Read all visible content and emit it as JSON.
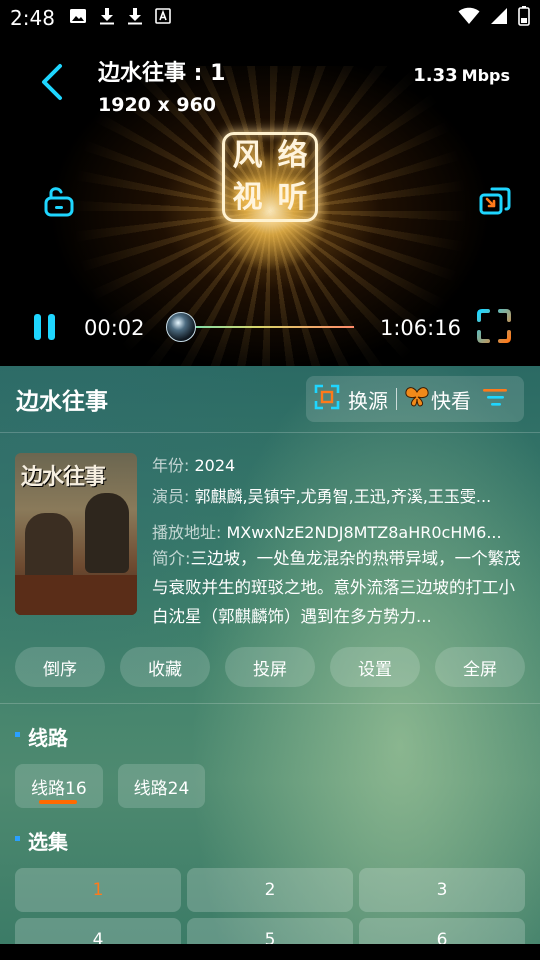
{
  "status_bar": {
    "time": "2:48",
    "left_icons": [
      "image-icon",
      "download-icon",
      "download-icon",
      "a-badge-icon"
    ],
    "right_icons": [
      "wifi-icon",
      "signal-icon",
      "battery-icon"
    ]
  },
  "player": {
    "title": "边水往事 : 1",
    "resolution": "1920 x 960",
    "bitrate_value": "1.33",
    "bitrate_unit": "Mbps",
    "logo_chars": [
      "风",
      "络",
      "视",
      "听"
    ],
    "current_time": "00:02",
    "total_time": "1:06:16",
    "accent_color": "#1fd6ff",
    "fullscreen_color": "#ff7a1a"
  },
  "details": {
    "title": "边水往事",
    "source_label": "换源",
    "quick_label": "快看",
    "poster_text": "边水往事",
    "year_label": "年份:",
    "year": "2024",
    "cast_label": "演员:",
    "cast": "郭麒麟,吴镇宇,尤勇智,王迅,齐溪,王玉雯...",
    "url_label": "播放地址:",
    "url": "MXwxNzE2NDJ8MTZ8aHR0cHM6...",
    "intro_label": "简介:",
    "intro": "三边坡，一处鱼龙混杂的热带异域，一个繁茂与衰败并生的斑驳之地。意外流落三边坡的打工小白沈星（郭麒麟饰）遇到在多方势力...",
    "actions": [
      "倒序",
      "收藏",
      "投屏",
      "设置",
      "全屏"
    ]
  },
  "lines": {
    "heading": "线路",
    "items": [
      "线路16",
      "线路24"
    ],
    "active_index": 0
  },
  "episodes": {
    "heading": "选集",
    "items": [
      "1",
      "2",
      "3",
      "4",
      "5",
      "6"
    ],
    "active_index": 0,
    "active_color": "#ff7a1a"
  }
}
